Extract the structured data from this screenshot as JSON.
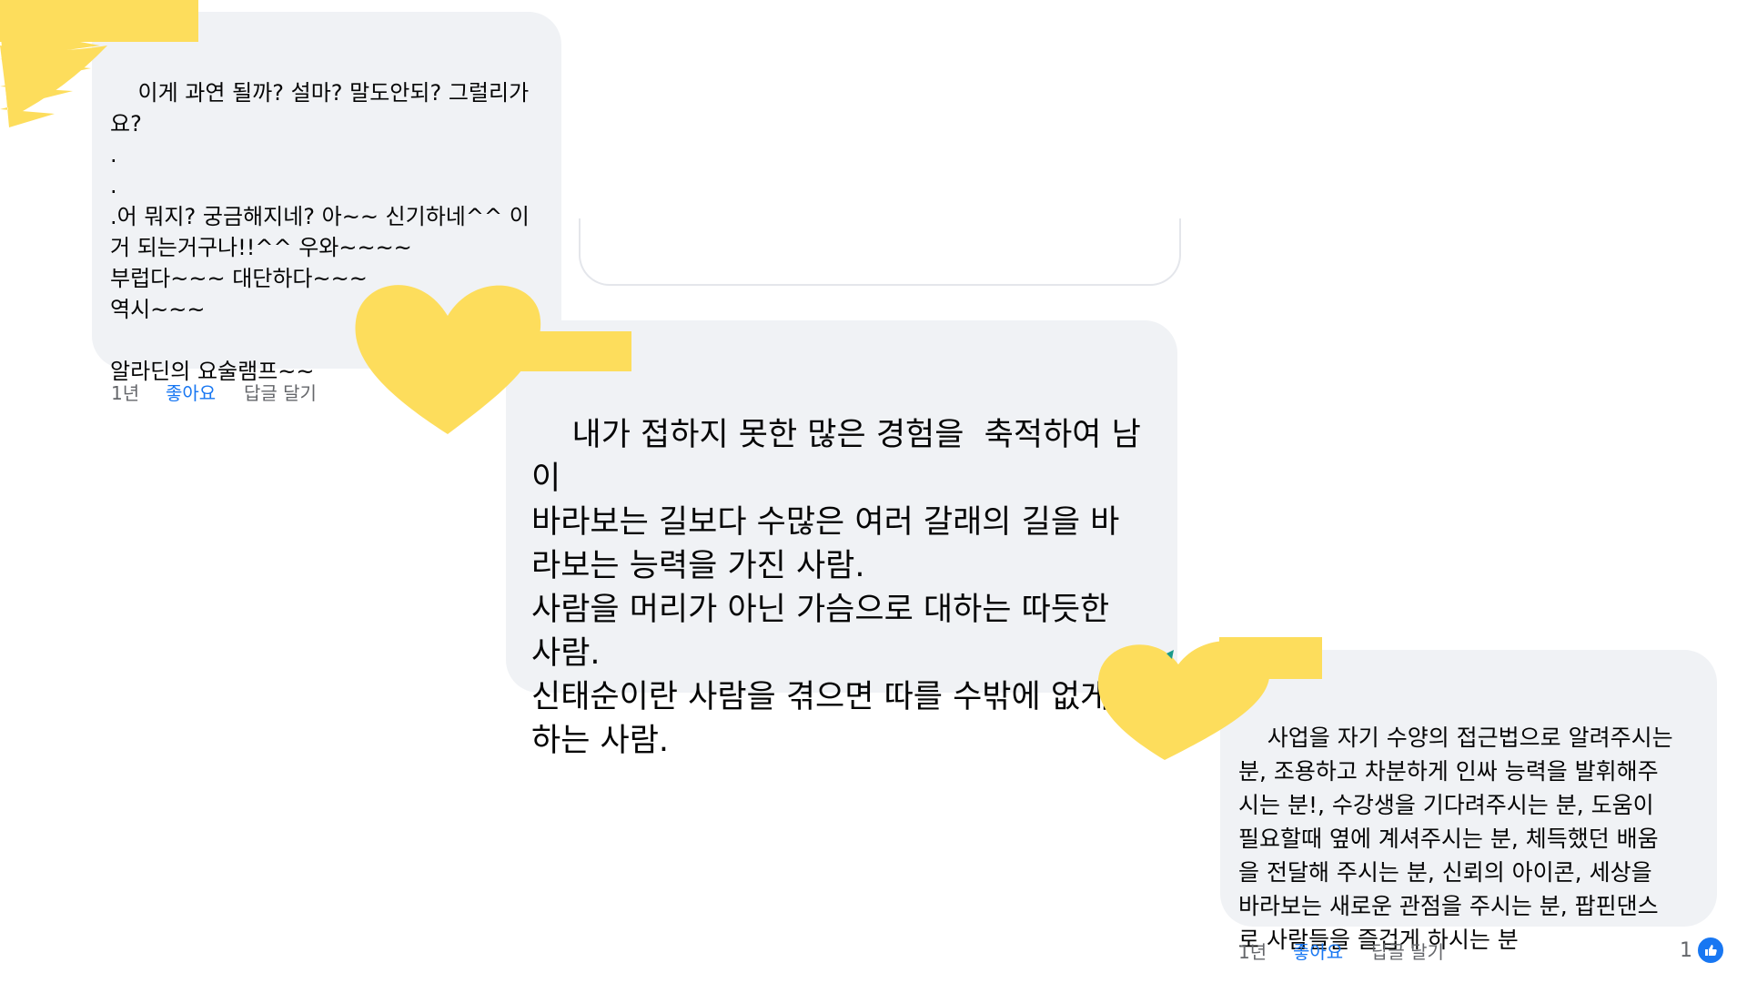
{
  "comments": [
    {
      "text": "이게 과연 될까? 설마? 말도안되? 그럴리가\n요?\n.\n.\n.어 뭐지? 궁금해지네? 아~~ 신기하네^^ 이\n거 되는거구나!!^^ 우와~~~~\n부럽다~~~ 대단하다~~~\n역시~~~\n\n알라딘의 요술램프~~",
      "time": "1년",
      "like_label": "좋아요",
      "reply_label": "답글 달기"
    },
    {
      "text": "내가 접하지 못한 많은 경험을  축적하여 남이\n바라보는 길보다 수많은 여러 갈래의 길을 바\n라보는 능력을 가진 사람.\n사람을 머리가 아닌 가슴으로 대하는 따듯한\n사람.\n신태순이란 사람을 겪으면 따를 수밖에 없게\n하는 사람."
    },
    {
      "text": "사업을 자기 수양의 접근법으로 알려주시는\n분, 조용하고 차분하게 인싸 능력을 발휘해주\n시는 분!, 수강생을 기다려주시는 분, 도움이\n필요할때 옆에 계셔주시는 분, 체득했던 배움\n을 전달해 주시는 분, 신뢰의 아이콘, 세상을\n바라보는 새로운 관점을 주시는 분, 팝핀댄스\n로 사람들을 즐겁게 하시는 분",
      "time": "1년",
      "like_label": "좋아요",
      "reply_label": "답글 달기",
      "reaction_count": "1",
      "reaction_icon": "like-thumb-icon"
    }
  ],
  "colors": {
    "bubble": "#f0f2f5",
    "like_blue": "#1877f2",
    "meta_gray": "#65676b",
    "highlight_yellow": "#fddd5c"
  }
}
